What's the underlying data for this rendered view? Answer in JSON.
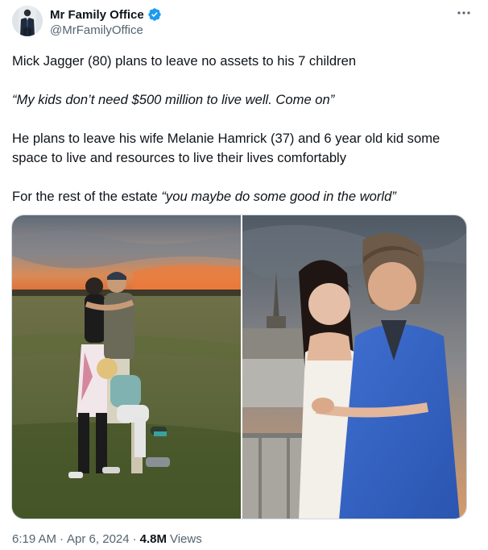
{
  "author": {
    "name": "Mr Family Office",
    "handle": "@MrFamilyOffice",
    "verified": true
  },
  "more_icon": "more-options-icon",
  "tweet": {
    "line1": "Mick Jagger (80) plans to leave no assets to his 7 children",
    "quote": "“My kids don’t need $500 million to live well. Come on”",
    "line3": "He plans to leave his wife Melanie Hamrick (37) and 6 year old kid some space to live and resources to live their lives comfortably",
    "line4_prefix": "For the rest of the estate ",
    "line4_quote": "“you maybe do some good in the world”"
  },
  "media": {
    "photo_left_icon": "family-hug-photo",
    "photo_right_icon": "couple-portrait-photo"
  },
  "meta": {
    "time": "6:19 AM",
    "date": "Apr 6, 2024",
    "views_count": "4.8M",
    "views_label": "Views",
    "separator": "·"
  },
  "colors": {
    "text_primary": "#0f1419",
    "text_secondary": "#536471",
    "verified_blue": "#1d9bf0",
    "border": "#cfd9de"
  }
}
